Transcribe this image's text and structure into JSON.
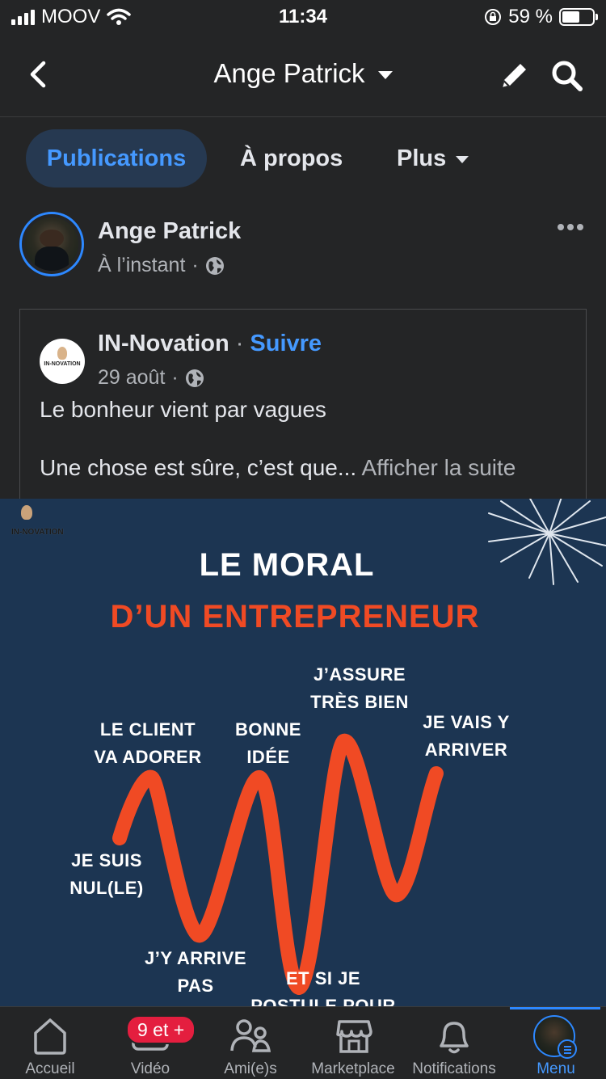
{
  "status_bar": {
    "carrier": "MOOV",
    "time": "11:34",
    "battery_percent": "59 %",
    "battery_level": 0.59
  },
  "nav": {
    "title": "Ange Patrick"
  },
  "tabs": [
    {
      "label": "Publications",
      "active": true
    },
    {
      "label": "À propos",
      "active": false
    },
    {
      "label": "Plus",
      "active": false
    }
  ],
  "post": {
    "author": "Ange Patrick",
    "time": "À l’instant",
    "separator": "·"
  },
  "shared": {
    "page_name": "IN-Novation",
    "separator": "·",
    "follow_label": "Suivre",
    "date": "29 août",
    "text_line1": "Le bonheur vient par vagues",
    "text_line2": "Une chose est sûre, c’est que...",
    "see_more": "Afficher la suite",
    "logo_text": "IN-NOVATION"
  },
  "image": {
    "brand": "IN-NOVATION",
    "title": "LE MORAL",
    "subtitle": "D’UN ENTREPRENEUR",
    "labels": {
      "nul_1": "JE SUIS",
      "nul_2": "NUL(LE)",
      "client_1": "LE CLIENT",
      "client_2": "VA ADORER",
      "arrive_pas_1": "J’Y ARRIVE",
      "arrive_pas_2": "PAS",
      "bonne_1": "BONNE",
      "bonne_2": "IDÉE",
      "postule_1": "ET SI JE",
      "postule_2": "POSTULE POUR",
      "assure_1": "J’ASSURE",
      "assure_2": "TRÈS BIEN",
      "vais_1": "JE VAIS Y",
      "vais_2": "ARRIVER"
    },
    "colors": {
      "background": "#1c3552",
      "accent": "#f04a24"
    }
  },
  "tab_bar": {
    "items": [
      {
        "label": "Accueil",
        "icon": "home-icon"
      },
      {
        "label": "Vidéo",
        "icon": "video-icon"
      },
      {
        "label": "Ami(e)s",
        "icon": "friends-icon"
      },
      {
        "label": "Marketplace",
        "icon": "marketplace-icon"
      },
      {
        "label": "Notifications",
        "icon": "bell-icon"
      },
      {
        "label": "Menu",
        "icon": "menu-avatar",
        "active": true
      }
    ],
    "video_badge": "9 et +"
  },
  "colors": {
    "brand_blue": "#2d88ff",
    "link_blue": "#4599ff",
    "badge_red": "#e41e3f"
  }
}
